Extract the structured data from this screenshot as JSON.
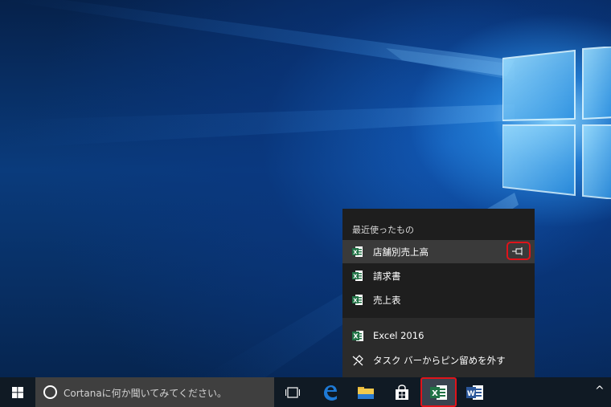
{
  "jumplist": {
    "section_title": "最近使ったもの",
    "recent": [
      {
        "label": "店舗別売上高",
        "icon": "excel-file-icon"
      },
      {
        "label": "請求書",
        "icon": "excel-file-icon"
      },
      {
        "label": "売上表",
        "icon": "excel-file-icon"
      }
    ],
    "pin_icon": "pin-icon",
    "app_label": "Excel 2016",
    "unpin_label": "タスク バーからピン留めを外す"
  },
  "taskbar": {
    "search_placeholder": "Cortanaに何か聞いてみてください。",
    "apps": [
      "task-view-icon",
      "edge-icon",
      "file-explorer-icon",
      "store-icon",
      "excel-icon",
      "word-icon"
    ],
    "chevron": "^"
  },
  "colors": {
    "highlight": "#e0131a",
    "excel_green": "#217346",
    "word_blue": "#2b579a",
    "edge_blue": "#1e7ad6"
  }
}
